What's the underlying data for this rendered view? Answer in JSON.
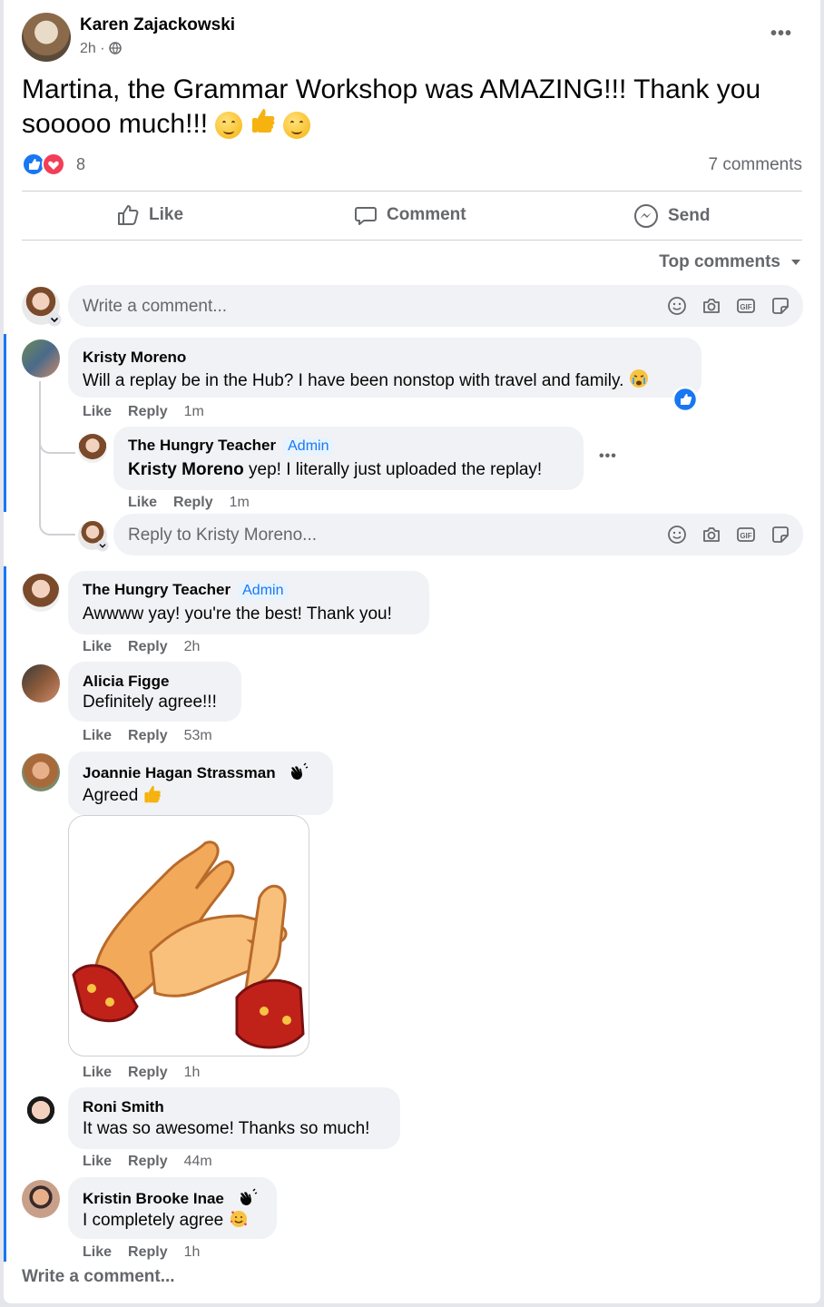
{
  "post": {
    "author": "Karen Zajackowski",
    "time": "2h ·",
    "text_line1": "Martina, the Grammar Workshop was AMAZING!!! Thank you",
    "text_line2": "sooooo much!!!",
    "reaction_count": "8",
    "comment_count": "7 comments"
  },
  "actions": {
    "like": "Like",
    "comment": "Comment",
    "send": "Send"
  },
  "sort": {
    "label": "Top comments"
  },
  "composer": {
    "placeholder": "Write a comment..."
  },
  "comments": [
    {
      "name": "Kristy Moreno",
      "text": "Will a replay be in the Hub? I have been nonstop with travel and family.",
      "like": "Like",
      "reply": "Reply",
      "time": "1m"
    },
    {
      "name": "The Hungry Teacher",
      "badge": "Admin",
      "mention": "Kristy Moreno",
      "text": " yep! I literally just uploaded the replay!",
      "like": "Like",
      "reply": "Reply",
      "time": "1m"
    },
    {
      "name": "The Hungry Teacher",
      "badge": "Admin",
      "text": "Awwww yay! you're the best! Thank you!",
      "like": "Like",
      "reply": "Reply",
      "time": "2h"
    },
    {
      "name": "Alicia Figge",
      "text": "Definitely agree!!!",
      "like": "Like",
      "reply": "Reply",
      "time": "53m"
    },
    {
      "name": "Joannie Hagan Strassman",
      "text": "Agreed",
      "like": "Like",
      "reply": "Reply",
      "time": "1h"
    },
    {
      "name": "Roni Smith",
      "text": "It was so awesome! Thanks so much!",
      "like": "Like",
      "reply": "Reply",
      "time": "44m"
    },
    {
      "name": "Kristin Brooke Inae",
      "text": "I completely agree",
      "like": "Like",
      "reply": "Reply",
      "time": "1h"
    }
  ],
  "reply_box": {
    "placeholder": "Reply to Kristy Moreno..."
  },
  "footer": {
    "write_comment": "Write a comment..."
  },
  "colors": {
    "accent": "#1877f2",
    "bubble": "#f0f2f5",
    "muted": "#65676b",
    "love": "#f33e58"
  }
}
